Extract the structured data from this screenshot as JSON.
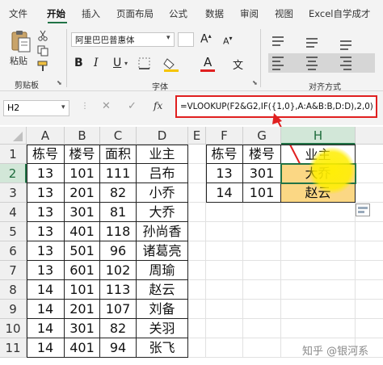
{
  "menu": {
    "tabs": [
      "文件",
      "开始",
      "插入",
      "页面布局",
      "公式",
      "数据",
      "审阅",
      "视图",
      "Excel自学成才"
    ],
    "active": "开始"
  },
  "ribbon": {
    "paste_label": "粘贴",
    "clipboard_label": "剪贴板",
    "font_name": "阿里巴巴普惠体",
    "font_group_label": "字体",
    "align_group_label": "对齐方式",
    "bold": "B",
    "italic": "I",
    "underline": "U",
    "font_color_letter": "A",
    "wen": "文",
    "accent_color": "#217346",
    "font_color_bar": "#e02020",
    "fill_color_bar": "#f5c400"
  },
  "formula_bar": {
    "name_box": "H2",
    "fx": "fx",
    "formula": "=VLOOKUP(F2&G2,IF({1,0},A:A&B:B,D:D),2,0)",
    "highlight_color": "#e02020"
  },
  "grid": {
    "columns": [
      "A",
      "B",
      "C",
      "D",
      "E",
      "F",
      "G",
      "H"
    ],
    "selected_column": "H",
    "rows": [
      "1",
      "2",
      "3",
      "4",
      "5",
      "6",
      "7",
      "8",
      "9",
      "10",
      "11"
    ],
    "selected_row": "2",
    "table1": {
      "headers": [
        "栋号",
        "楼号",
        "面积",
        "业主"
      ],
      "rows": [
        [
          "13",
          "101",
          "111",
          "吕布"
        ],
        [
          "13",
          "201",
          "82",
          "小乔"
        ],
        [
          "13",
          "301",
          "81",
          "大乔"
        ],
        [
          "13",
          "401",
          "118",
          "孙尚香"
        ],
        [
          "13",
          "501",
          "96",
          "诸葛亮"
        ],
        [
          "13",
          "601",
          "102",
          "周瑜"
        ],
        [
          "14",
          "101",
          "113",
          "赵云"
        ],
        [
          "14",
          "201",
          "107",
          "刘备"
        ],
        [
          "14",
          "301",
          "82",
          "关羽"
        ],
        [
          "14",
          "401",
          "94",
          "张飞"
        ]
      ]
    },
    "table2": {
      "headers": [
        "栋号",
        "楼号",
        "业主"
      ],
      "rows": [
        [
          "13",
          "301",
          "大乔"
        ],
        [
          "14",
          "101",
          "赵云"
        ]
      ]
    },
    "highlight_fill": "#fbd784"
  },
  "watermark": "知乎 @银河系"
}
